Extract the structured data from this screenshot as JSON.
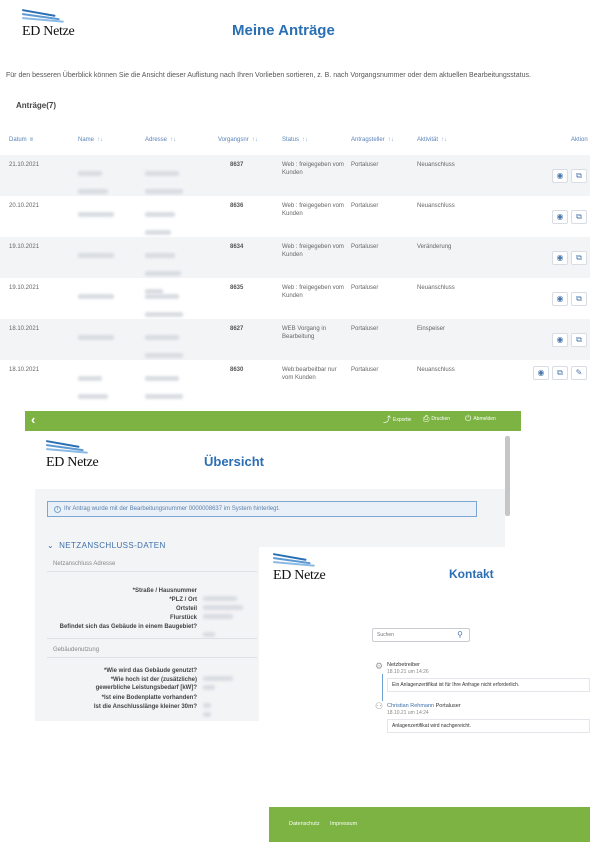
{
  "brand": {
    "logo_text": "ED Netze"
  },
  "antraege": {
    "title": "Meine Anträge",
    "intro": "Für den besseren Überblick können Sie die Ansicht dieser Auflistung nach Ihren Vorlieben sortieren, z. B. nach Vorgangsnummer oder dem aktuellen Bearbeitungsstatus.",
    "count_label": "Anträge(7)",
    "columns": {
      "datum": "Datum",
      "name": "Name",
      "adresse": "Adresse",
      "vorgangsnr": "Vorgangsnr",
      "status": "Status",
      "antragsteller": "Antragsteller",
      "aktivitaet": "Aktivität",
      "aktion": "Aktion"
    },
    "rows": [
      {
        "datum": "21.10.2021",
        "vorgangsnr": "8637",
        "status": "Web : freigegeben vom Kunden",
        "antragsteller": "Portaluser",
        "aktivitaet": "Neuanschluss"
      },
      {
        "datum": "20.10.2021",
        "vorgangsnr": "8636",
        "status": "Web : freigegeben vom Kunden",
        "antragsteller": "Portaluser",
        "aktivitaet": "Neuanschluss"
      },
      {
        "datum": "19.10.2021",
        "vorgangsnr": "8634",
        "status": "Web : freigegeben vom Kunden",
        "antragsteller": "Portaluser",
        "aktivitaet": "Veränderung"
      },
      {
        "datum": "19.10.2021",
        "vorgangsnr": "8635",
        "status": "Web : freigegeben vom Kunden",
        "antragsteller": "Portaluser",
        "aktivitaet": "Neuanschluss"
      },
      {
        "datum": "18.10.2021",
        "vorgangsnr": "8627",
        "status": "WEB Vorgang in Bearbeitung",
        "antragsteller": "Portaluser",
        "aktivitaet": "Einspeiser"
      },
      {
        "datum": "18.10.2021",
        "vorgangsnr": "8630",
        "status": "Web:bearbeitbar nur vom Kunden",
        "antragsteller": "Portaluser",
        "aktivitaet": "Neuanschluss"
      }
    ]
  },
  "uebersicht": {
    "toolbar": {
      "export": "Exportie",
      "drucken": "Drucken",
      "abmelden": "Abmelden"
    },
    "title": "Übersicht",
    "info": "Ihr Antrag wurde mit der Bearbeitungsnummer 0000008637 im System hinterlegt.",
    "section_title": "NETZANSCHLUSS-DATEN",
    "sub_adresse": "Netzanschluss Adresse",
    "adresse_fields": [
      "*Straße / Hausnummer",
      "*PLZ / Ort",
      "Ortsteil",
      "Flurstück",
      "Befindet sich das Gebäude in einem Baugebiet?"
    ],
    "sub_gebaeude": "Gebäudenutzung",
    "gebaeude_fields": [
      "*Wie wird das Gebäude genutzt?",
      "*Wie hoch ist der (zusätzliche) gewerbliche Leistungsbedarf [kW]?",
      "*Ist eine Bodenplatte vorhanden?",
      "Ist die Anschlusslänge kleiner 30m?"
    ]
  },
  "kontakt": {
    "title": "Kontakt",
    "search_placeholder": "Suchen",
    "messages": [
      {
        "from": "Netzbetreiber",
        "role": "",
        "time": "18.10.21 um 14:26",
        "text": "Ein Anlagenzertifikat ist für Ihre Anfrage nicht erforderlich."
      },
      {
        "from": "Christian Rehmann",
        "role": "Portaluser",
        "time": "18.10.21 um 14:24",
        "text": "Anlagenzertifikat wird nachgereicht."
      }
    ],
    "footer": {
      "datenschutz": "Datenschutz",
      "impressum": "Impressum"
    }
  },
  "colors": {
    "brand_blue": "#2a6fb3",
    "accent_green": "#7cb342",
    "stripe": "#f2f4f6"
  }
}
